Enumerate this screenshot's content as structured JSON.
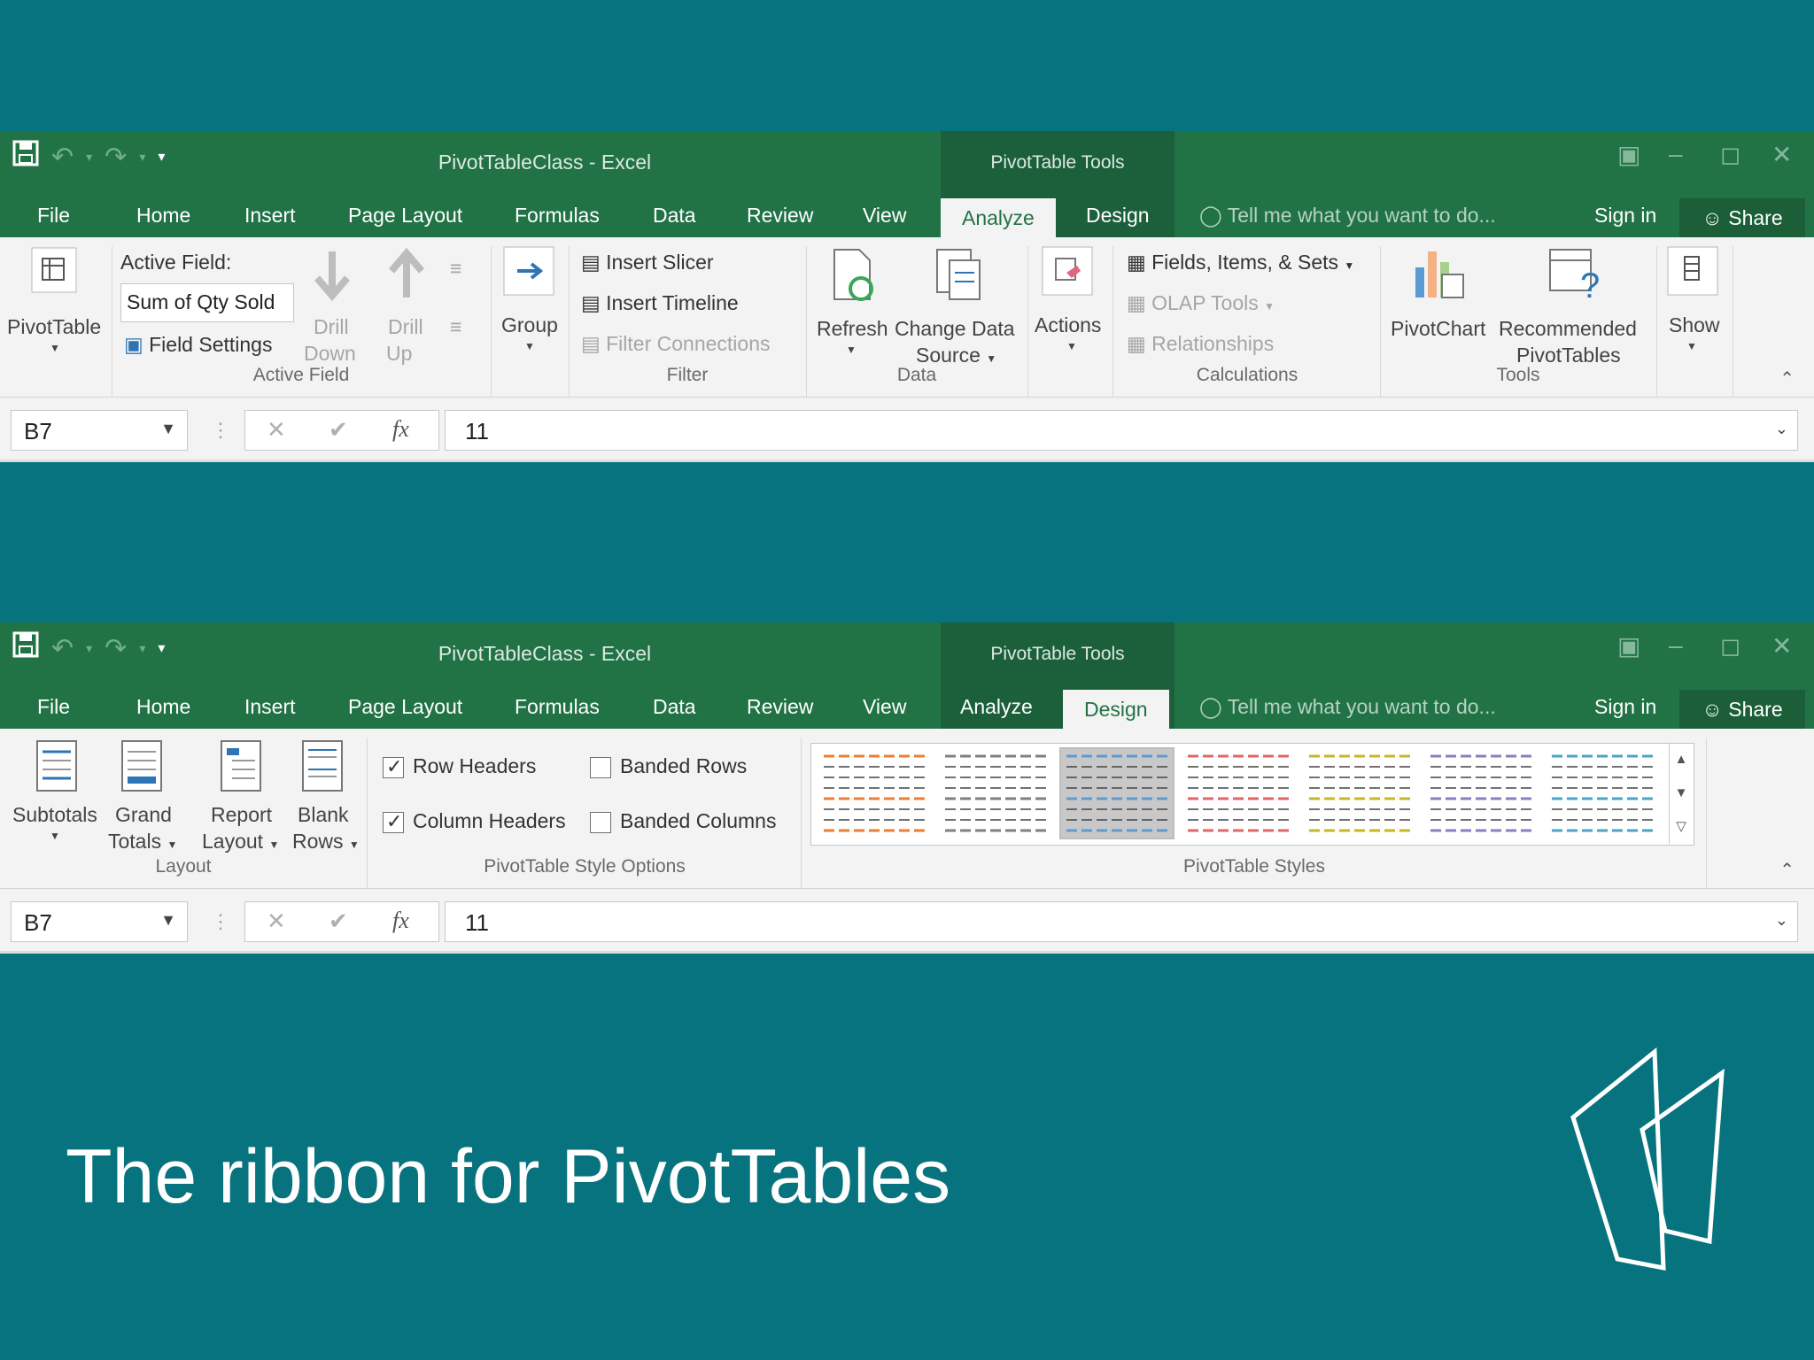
{
  "excel1": {
    "title": "PivotTableClass - Excel",
    "context_title": "PivotTable Tools",
    "tabs": [
      "File",
      "Home",
      "Insert",
      "Page Layout",
      "Formulas",
      "Data",
      "Review",
      "View",
      "Analyze",
      "Design"
    ],
    "active_tab": "Analyze",
    "tell_me": "Tell me what you want to do...",
    "sign_in": "Sign in",
    "share": "Share",
    "ribbon": {
      "pivottable": "PivotTable",
      "active_field_label": "Active Field:",
      "active_field_value": "Sum of Qty Sold",
      "field_settings": "Field Settings",
      "drill_down_1": "Drill",
      "drill_down_2": "Down",
      "drill_up_1": "Drill",
      "drill_up_2": "Up",
      "group_active_field": "Active Field",
      "group_btn": "Group",
      "insert_slicer": "Insert Slicer",
      "insert_timeline": "Insert Timeline",
      "filter_connections": "Filter Connections",
      "group_filter": "Filter",
      "refresh": "Refresh",
      "change_data_1": "Change Data",
      "change_data_2": "Source",
      "group_data": "Data",
      "actions": "Actions",
      "fields_items_sets": "Fields, Items, & Sets",
      "olap_tools": "OLAP Tools",
      "relationships": "Relationships",
      "group_calculations": "Calculations",
      "pivotchart": "PivotChart",
      "recommended_1": "Recommended",
      "recommended_2": "PivotTables",
      "group_tools": "Tools",
      "show": "Show"
    },
    "formula_bar": {
      "name_box": "B7",
      "value": "11"
    }
  },
  "excel2": {
    "title": "PivotTableClass - Excel",
    "context_title": "PivotTable Tools",
    "tabs": [
      "File",
      "Home",
      "Insert",
      "Page Layout",
      "Formulas",
      "Data",
      "Review",
      "View",
      "Analyze",
      "Design"
    ],
    "active_tab": "Design",
    "tell_me": "Tell me what you want to do...",
    "sign_in": "Sign in",
    "share": "Share",
    "ribbon": {
      "subtotals": "Subtotals",
      "grand_1": "Grand",
      "grand_2": "Totals",
      "report_1": "Report",
      "report_2": "Layout",
      "blank_1": "Blank",
      "blank_2": "Rows",
      "group_layout": "Layout",
      "row_headers": "Row Headers",
      "column_headers": "Column Headers",
      "banded_rows": "Banded Rows",
      "banded_columns": "Banded Columns",
      "group_style_options": "PivotTable Style Options",
      "group_styles": "PivotTable Styles",
      "row_headers_checked": true,
      "column_headers_checked": true,
      "banded_rows_checked": false,
      "banded_columns_checked": false,
      "style_colors": [
        "#ed7d31",
        "#7f7f7f",
        "#5b9bd5",
        "#e06666",
        "#c9b526",
        "#8e7cc3",
        "#4aa3c9"
      ]
    },
    "formula_bar": {
      "name_box": "B7",
      "value": "11"
    }
  },
  "slide": {
    "title": "The ribbon for PivotTables"
  },
  "colors": {
    "background": "#07737f",
    "excel_green": "#217346",
    "ribbon_bg": "#f3f3f3"
  }
}
